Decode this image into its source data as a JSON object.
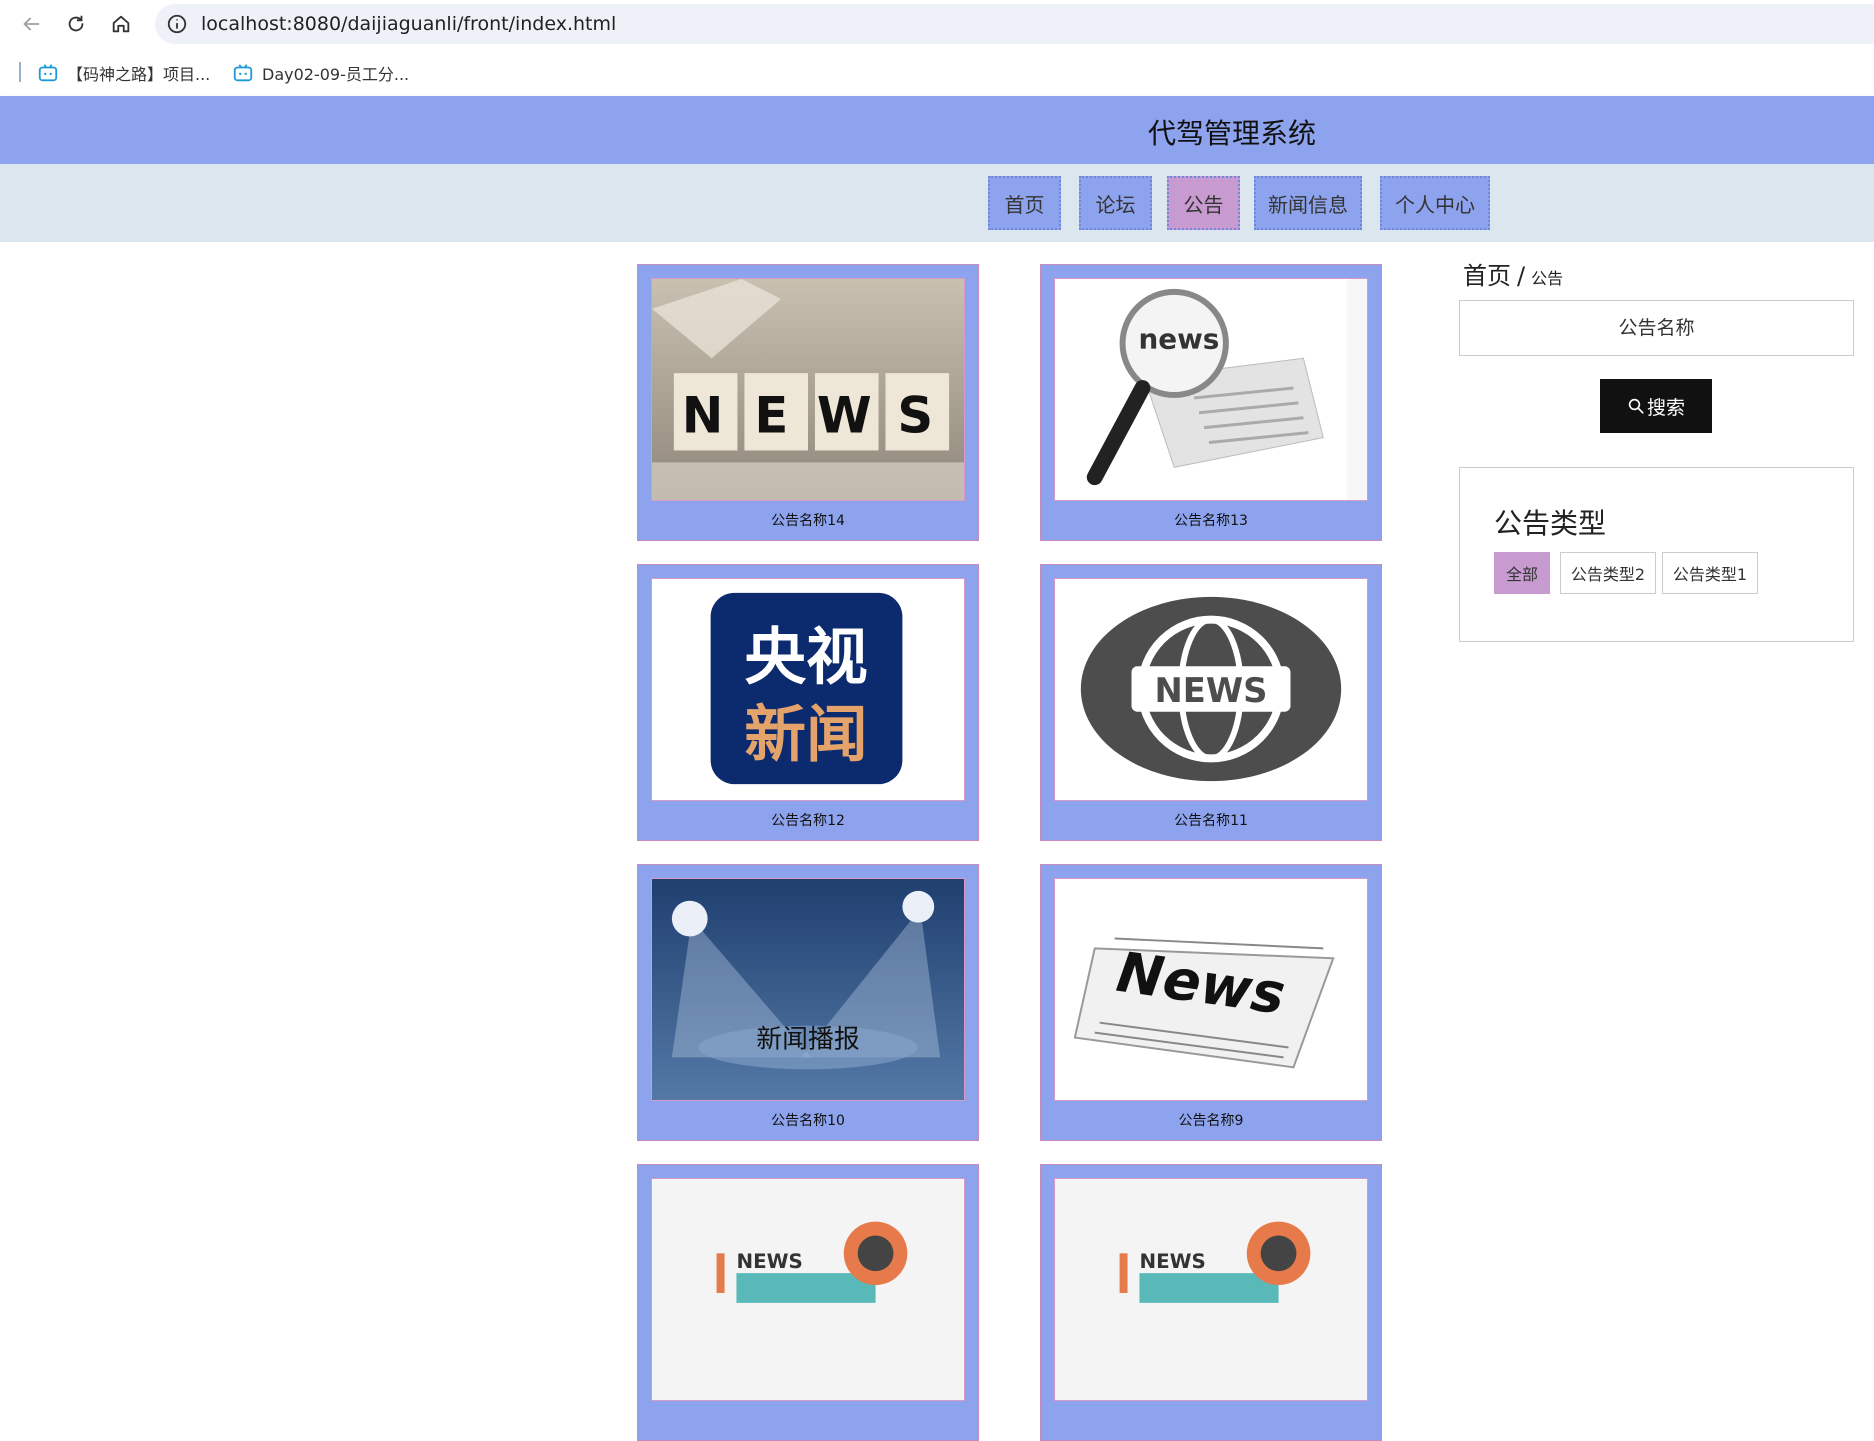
{
  "browser": {
    "url": "localhost:8080/daijiaguanli/front/index.html",
    "bookmarks": [
      {
        "label": "【码神之路】项目..."
      },
      {
        "label": "Day02-09-员工分..."
      }
    ]
  },
  "site": {
    "title": "代驾管理系统",
    "menu": [
      {
        "label": "首页",
        "active": false
      },
      {
        "label": "论坛",
        "active": false
      },
      {
        "label": "公告",
        "active": true
      },
      {
        "label": "新闻信息",
        "active": false
      },
      {
        "label": "个人中心",
        "active": false
      }
    ]
  },
  "breadcrumb": {
    "home": "首页",
    "separator": "/",
    "current": "公告"
  },
  "search": {
    "placeholder": "公告名称",
    "button_label": "搜索"
  },
  "types": {
    "title": "公告类型",
    "tags": [
      {
        "label": "全部",
        "active": true
      },
      {
        "label": "公告类型2",
        "active": false
      },
      {
        "label": "公告类型1",
        "active": false
      }
    ]
  },
  "cards": [
    {
      "name": "公告名称14",
      "image": "news-dice"
    },
    {
      "name": "公告名称13",
      "image": "magnifier-news"
    },
    {
      "name": "公告名称12",
      "image": "cctv-news-logo",
      "image_text": [
        "央视",
        "新闻"
      ]
    },
    {
      "name": "公告名称11",
      "image": "globe-news",
      "image_text": "NEWS"
    },
    {
      "name": "公告名称10",
      "image": "spotlight-stage",
      "image_text": "新闻播报"
    },
    {
      "name": "公告名称9",
      "image": "newspaper",
      "image_text": "News"
    },
    {
      "name": "",
      "image": "news-sign"
    },
    {
      "name": "",
      "image": "news-sign"
    }
  ],
  "colors": {
    "header": "#8ea3ee",
    "menu_bg": "#dce6ef",
    "active": "#c79bd0",
    "search_button": "#111111"
  }
}
